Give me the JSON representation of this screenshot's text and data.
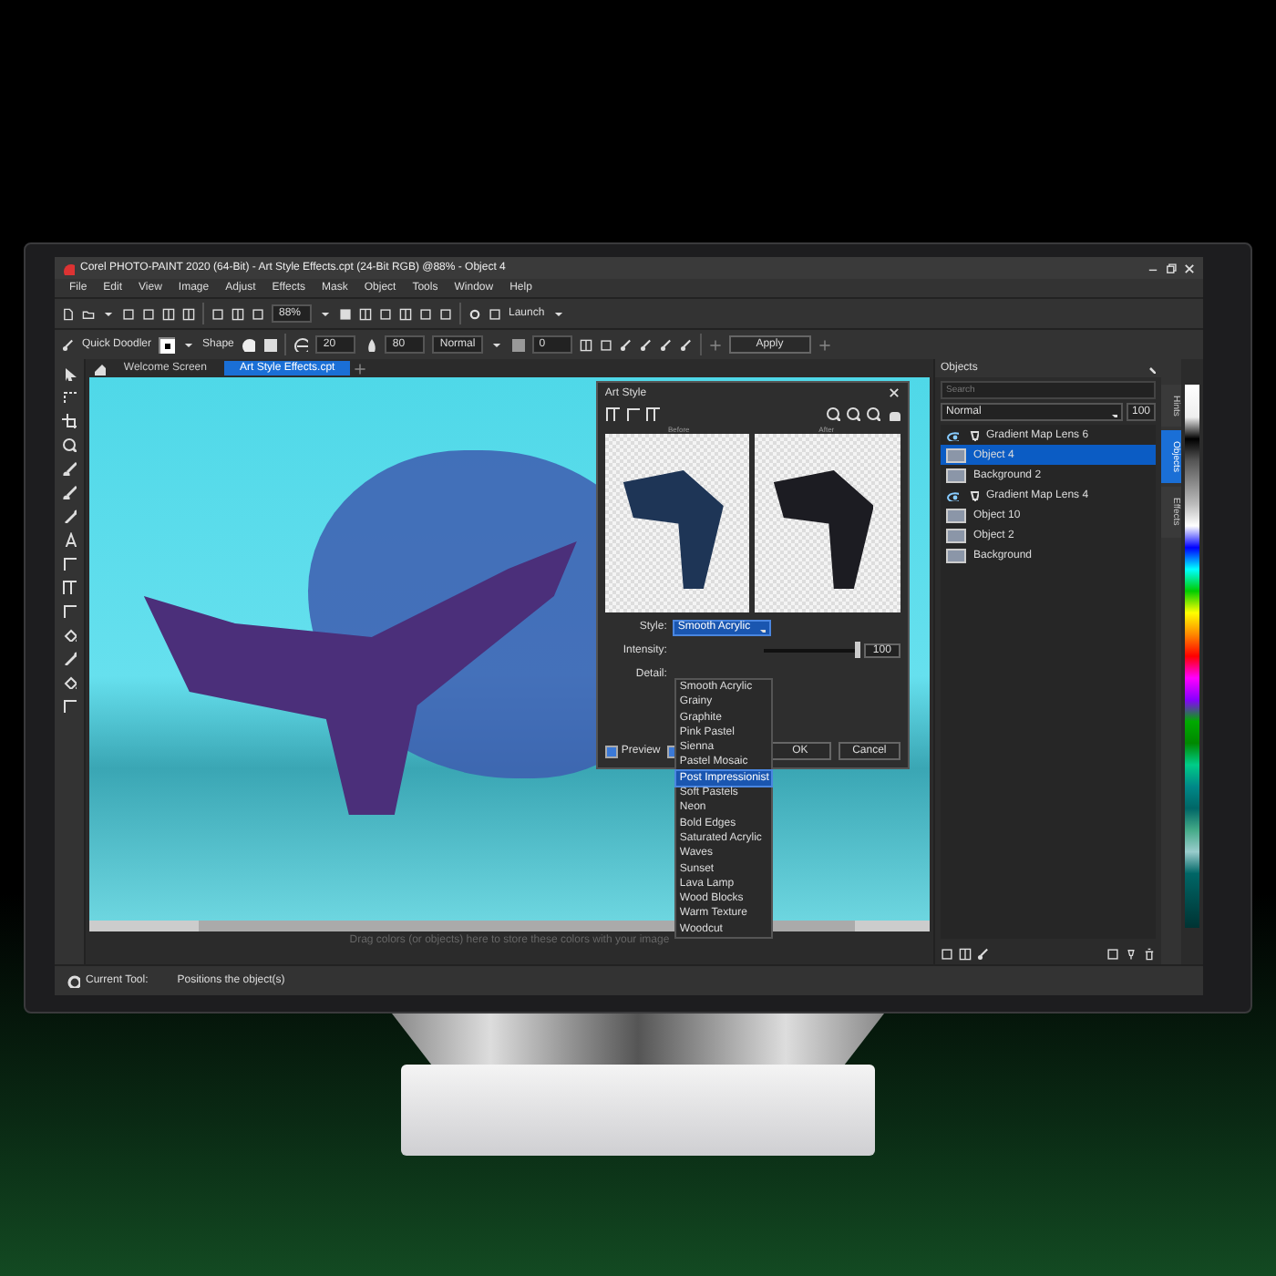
{
  "window": {
    "title": "Corel PHOTO-PAINT 2020 (64-Bit) - Art Style Effects.cpt (24-Bit RGB) @88% - Object 4"
  },
  "menu": [
    "File",
    "Edit",
    "View",
    "Image",
    "Adjust",
    "Effects",
    "Mask",
    "Object",
    "Tools",
    "Window",
    "Help"
  ],
  "toolbar": {
    "zoom": "88%",
    "launch": "Launch"
  },
  "property_bar": {
    "tool": "Quick Doodler",
    "shape_label": "Shape",
    "size": "20",
    "transparency": "80",
    "merge_mode": "Normal",
    "feather": "0",
    "apply": "Apply"
  },
  "document_tabs": [
    {
      "label": "Welcome Screen",
      "selected": false
    },
    {
      "label": "Art Style Effects.cpt",
      "selected": true
    }
  ],
  "canvas": {
    "hint": "Drag colors (or objects) here to store these colors with your image"
  },
  "dialog": {
    "title": "Art Style",
    "before_label": "Before",
    "after_label": "After",
    "style_label": "Style:",
    "style_value": "Smooth Acrylic",
    "intensity_label": "Intensity:",
    "intensity": {
      "level": 1,
      "reading": "100"
    },
    "detail_label": "Detail:",
    "preview": {
      "label": "Preview",
      "checked": true
    },
    "second_option_checked": true,
    "buttons": [
      "OK",
      "Cancel"
    ],
    "style_options": [
      {
        "label": "Smooth Acrylic",
        "selected": false
      },
      {
        "label": "Grainy",
        "selected": false
      },
      {
        "label": "Graphite",
        "selected": false
      },
      {
        "label": "Pink Pastel",
        "selected": false
      },
      {
        "label": "Sienna",
        "selected": false
      },
      {
        "label": "Pastel Mosaic",
        "selected": false
      },
      {
        "label": "Post Impressionist",
        "selected": true
      },
      {
        "label": "Soft Pastels",
        "selected": false
      },
      {
        "label": "Neon",
        "selected": false
      },
      {
        "label": "Bold Edges",
        "selected": false
      },
      {
        "label": "Saturated Acrylic",
        "selected": false
      },
      {
        "label": "Waves",
        "selected": false
      },
      {
        "label": "Sunset",
        "selected": false
      },
      {
        "label": "Lava Lamp",
        "selected": false
      },
      {
        "label": "Wood Blocks",
        "selected": false
      },
      {
        "label": "Warm Texture",
        "selected": false
      },
      {
        "label": "Woodcut",
        "selected": false
      }
    ]
  },
  "objects_panel": {
    "title": "Objects",
    "search_placeholder": "Search",
    "blend_mode": "Normal",
    "opacity": "100",
    "items": [
      {
        "name": "Gradient Map Lens 6",
        "kind": "lens",
        "selected": false
      },
      {
        "name": "Object 4",
        "kind": "object",
        "selected": true
      },
      {
        "name": "Background 2",
        "kind": "object",
        "selected": false
      },
      {
        "name": "Gradient Map Lens 4",
        "kind": "lens",
        "selected": false
      },
      {
        "name": "Object 10",
        "kind": "object",
        "selected": false
      },
      {
        "name": "Object 2",
        "kind": "object",
        "selected": false
      },
      {
        "name": "Background",
        "kind": "object",
        "selected": false
      }
    ],
    "side_tabs": [
      {
        "label": "Hints",
        "selected": false
      },
      {
        "label": "Objects",
        "selected": true
      },
      {
        "label": "Effects",
        "selected": false
      }
    ]
  },
  "status_bar": {
    "label": "Current Tool:",
    "text": "Positions the object(s)"
  }
}
